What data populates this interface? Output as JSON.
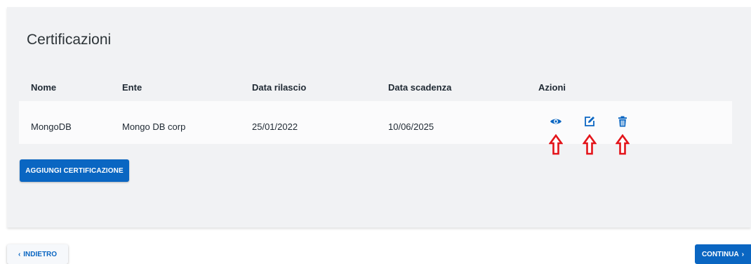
{
  "card": {
    "title": "Certificazioni",
    "table": {
      "headers": [
        "Nome",
        "Ente",
        "Data rilascio",
        "Data scadenza",
        "Azioni"
      ],
      "rows": [
        {
          "nome": "MongoDB",
          "ente": "Mongo DB corp",
          "data_rilascio": "25/01/2022",
          "data_scadenza": "10/06/2025",
          "actions": [
            "eye-icon",
            "edit-icon",
            "trash-icon"
          ]
        }
      ]
    },
    "add_button_label": "AGGIUNGI CERTIFICAZIONE"
  },
  "footer": {
    "back_chevron": "‹",
    "back_label": "INDIETRO",
    "next_label": "CONTINUA",
    "next_chevron": "›"
  },
  "colors": {
    "primary": "#0a66c2",
    "annotation_arrow": "#e3141a",
    "card_bg": "#f1f2f4"
  }
}
